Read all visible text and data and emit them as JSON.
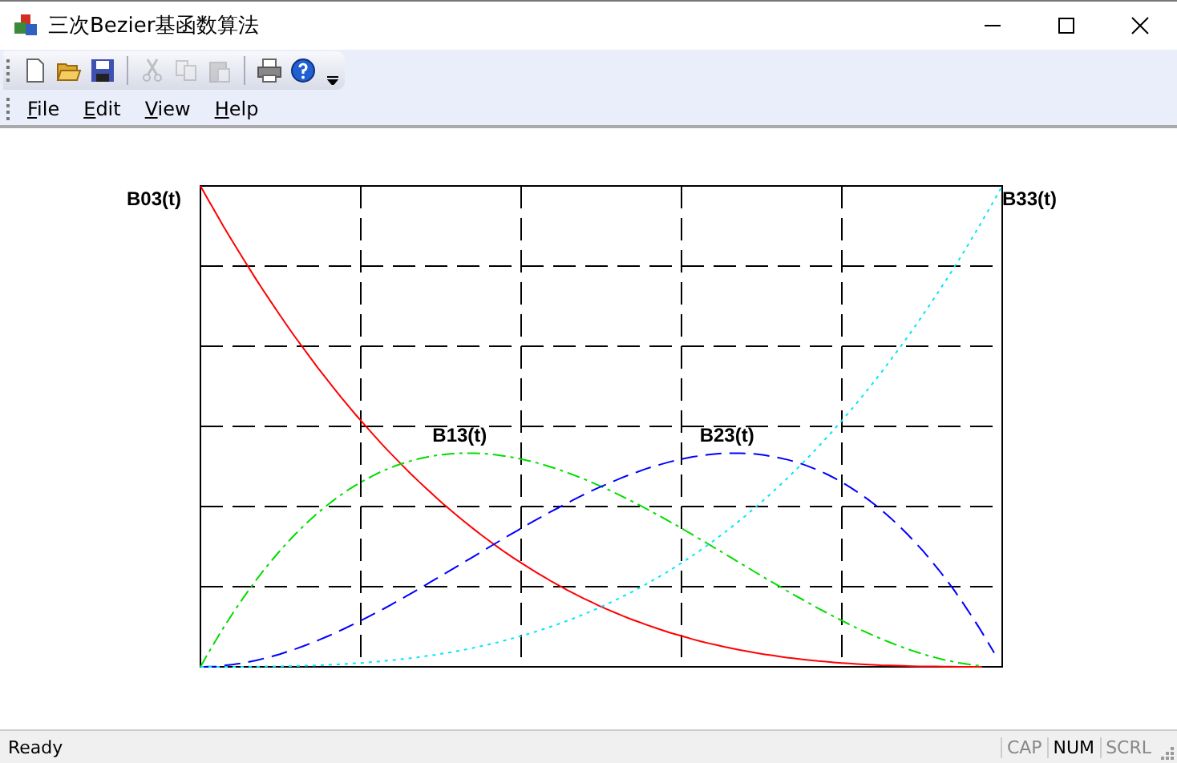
{
  "window": {
    "title": "三次Bezier基函数算法"
  },
  "toolbar": [
    {
      "kind": "new",
      "disabled": false
    },
    {
      "kind": "open",
      "disabled": false
    },
    {
      "kind": "save",
      "disabled": false
    },
    {
      "kind": "separator"
    },
    {
      "kind": "cut",
      "disabled": true
    },
    {
      "kind": "copy",
      "disabled": true
    },
    {
      "kind": "paste",
      "disabled": true
    },
    {
      "kind": "separator"
    },
    {
      "kind": "print",
      "disabled": false
    },
    {
      "kind": "help",
      "disabled": false
    }
  ],
  "menu": [
    "File",
    "Edit",
    "View",
    "Help"
  ],
  "plot": {
    "curves": [
      {
        "label": "B03(t)",
        "color": "#ff0000",
        "kind": "solid"
      },
      {
        "label": "B13(t)",
        "color": "#00dd00",
        "kind": "dashdot"
      },
      {
        "label": "B23(t)",
        "color": "#0000ff",
        "kind": "dash"
      },
      {
        "label": "B33(t)",
        "color": "#00e5ff",
        "kind": "dot"
      }
    ]
  },
  "status_bar": {
    "text": "Ready",
    "indicators": [
      {
        "label": "CAP",
        "on": false
      },
      {
        "label": "NUM",
        "on": true
      },
      {
        "label": "SCRL",
        "on": false
      }
    ]
  }
}
